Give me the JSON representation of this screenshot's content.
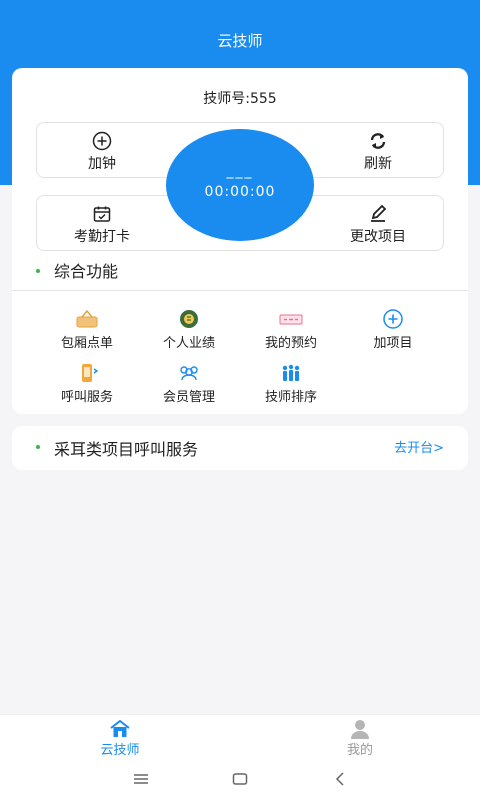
{
  "header": {
    "title": "云技师",
    "bg_color": "#1a8cf0"
  },
  "tech": {
    "number_label": "技师号:555"
  },
  "actions": {
    "add_clock": {
      "label": "加钟",
      "icon": "plus-circle-icon"
    },
    "refresh": {
      "label": "刷新",
      "icon": "refresh-icon"
    },
    "attendance": {
      "label": "考勤打卡",
      "icon": "calendar-check-icon"
    },
    "change_project": {
      "label": "更改项目",
      "icon": "edit-icon"
    }
  },
  "timer": {
    "status": "___",
    "time": "00:00:00"
  },
  "functions": {
    "title": "综合功能",
    "items": [
      {
        "label": "包厢点单",
        "icon": "basket-icon"
      },
      {
        "label": "个人业绩",
        "icon": "coins-icon"
      },
      {
        "label": "我的预约",
        "icon": "ticket-icon"
      },
      {
        "label": "加项目",
        "icon": "plus-circle-icon"
      },
      {
        "label": "呼叫服务",
        "icon": "phone-call-icon"
      },
      {
        "label": "会员管理",
        "icon": "members-icon"
      },
      {
        "label": "技师排序",
        "icon": "queue-icon"
      }
    ]
  },
  "service": {
    "title": "采耳类项目呼叫服务",
    "link": "去开台>"
  },
  "tabbar": {
    "home": {
      "label": "云技师",
      "icon": "home-icon"
    },
    "mine": {
      "label": "我的",
      "icon": "user-icon"
    }
  },
  "system_nav": {
    "menu": "menu-icon",
    "home": "square-icon",
    "back": "back-arrow-icon"
  }
}
